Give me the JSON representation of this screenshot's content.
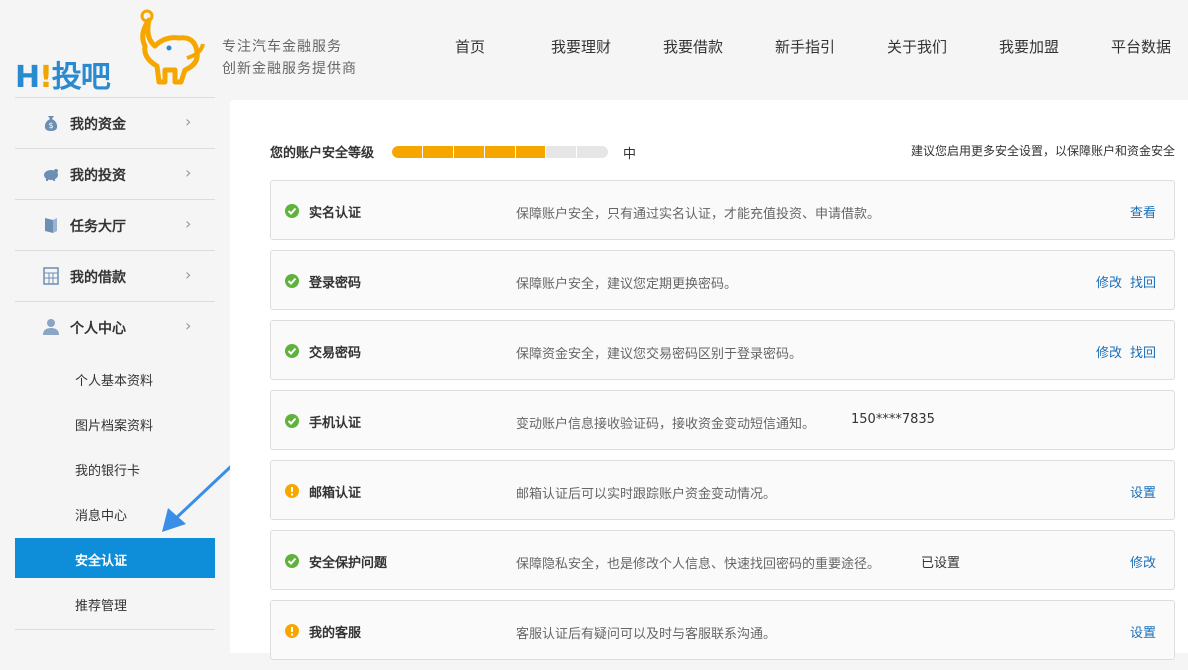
{
  "brand": {
    "logo_text_h": "H",
    "logo_text_excl": "!",
    "logo_text_rest": "投吧",
    "slogan_line1": "专注汽车金融服务",
    "slogan_line2": "创新金融服务提供商"
  },
  "nav": [
    "首页",
    "我要理财",
    "我要借款",
    "新手指引",
    "关于我们",
    "我要加盟",
    "平台数据"
  ],
  "sidebar": {
    "items": [
      {
        "label": "我的资金",
        "icon": "money-bag-icon"
      },
      {
        "label": "我的投资",
        "icon": "piggy-bank-icon"
      },
      {
        "label": "任务大厅",
        "icon": "book-icon"
      },
      {
        "label": "我的借款",
        "icon": "calculator-icon"
      },
      {
        "label": "个人中心",
        "icon": "user-icon"
      }
    ],
    "chevron": "›",
    "sub_items": [
      "个人基本资料",
      "图片档案资料",
      "我的银行卡",
      "消息中心",
      "安全认证",
      "推荐管理"
    ],
    "active_sub": "安全认证"
  },
  "security": {
    "level_label": "您的账户安全等级",
    "level_value": "中",
    "level_fraction": 0.71,
    "tip": "建议您启用更多安全设置，以保障账户和资金安全",
    "rows": [
      {
        "status": "ok",
        "title": "实名认证",
        "desc": "保障账户安全，只有通过实名认证，才能充值投资、申请借款。",
        "extra": "",
        "actions": [
          "查看"
        ]
      },
      {
        "status": "ok",
        "title": "登录密码",
        "desc": "保障账户安全，建议您定期更换密码。",
        "extra": "",
        "actions": [
          "修改",
          "找回"
        ]
      },
      {
        "status": "ok",
        "title": "交易密码",
        "desc": "保障资金安全，建议您交易密码区别于登录密码。",
        "extra": "",
        "actions": [
          "修改",
          "找回"
        ]
      },
      {
        "status": "ok",
        "title": "手机认证",
        "desc": "变动账户信息接收验证码，接收资金变动短信通知。",
        "extra": "150****7835",
        "actions": []
      },
      {
        "status": "warn",
        "title": "邮箱认证",
        "desc": "邮箱认证后可以实时跟踪账户资金变动情况。",
        "extra": "",
        "actions": [
          "设置"
        ]
      },
      {
        "status": "ok",
        "title": "安全保护问题",
        "desc": "保障隐私安全，也是修改个人信息、快速找回密码的重要途径。",
        "extra": "已设置",
        "actions": [
          "修改"
        ]
      },
      {
        "status": "warn",
        "title": "我的客服",
        "desc": "客服认证后有疑问可以及时与客服联系沟通。",
        "extra": "",
        "actions": [
          "设置"
        ]
      }
    ]
  },
  "colors": {
    "accent": "#0e8dd8",
    "progress": "#f5a700",
    "ok": "#5fb23c",
    "warn": "#f5a700",
    "link": "#1a6fb8"
  }
}
